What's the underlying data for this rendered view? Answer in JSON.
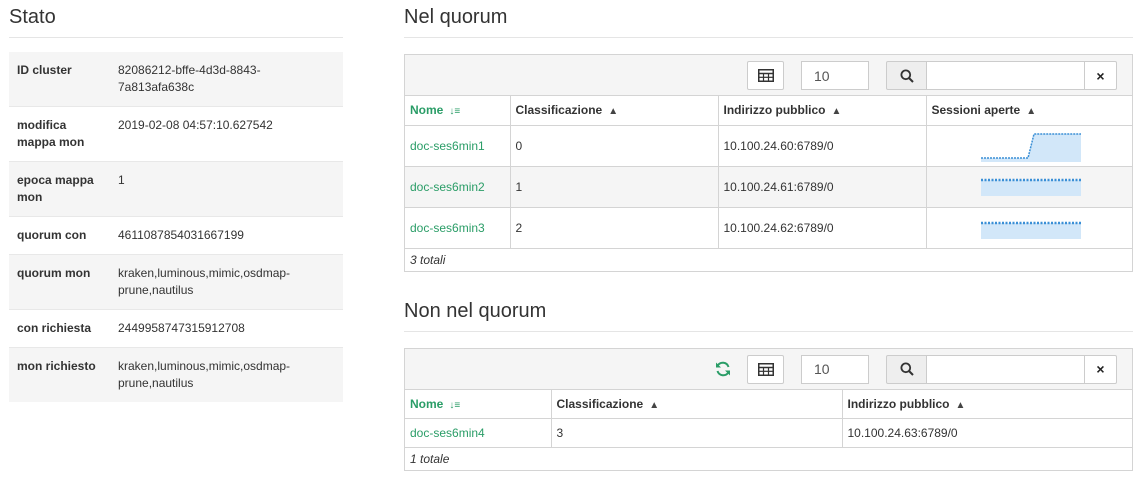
{
  "status": {
    "title": "Stato",
    "rows": [
      {
        "key": "ID cluster",
        "value": "82086212-bffe-4d3d-8843-\n7a813afa638c"
      },
      {
        "key": "modifica mappa mon",
        "value": "2019-02-08 04:57:10.627542"
      },
      {
        "key": "epoca mappa mon",
        "value": "1"
      },
      {
        "key": "quorum con",
        "value": "4611087854031667199"
      },
      {
        "key": "quorum mon",
        "value": "kraken,luminous,mimic,osdmap-prune,nautilus"
      },
      {
        "key": "con richiesta",
        "value": "2449958747315912708"
      },
      {
        "key": "mon richiesto",
        "value": "kraken,luminous,mimic,osdmap-prune,nautilus"
      }
    ]
  },
  "in_quorum": {
    "title": "Nel quorum",
    "page_size": "10",
    "search_placeholder": "",
    "clear_label": "×",
    "columns": [
      "Nome",
      "Classificazione",
      "Indirizzo pubblico",
      "Sessioni aperte"
    ],
    "rows": [
      {
        "name": "doc-ses6min1",
        "rank": "0",
        "address": "10.100.24.60:6789/0"
      },
      {
        "name": "doc-ses6min2",
        "rank": "1",
        "address": "10.100.24.61:6789/0"
      },
      {
        "name": "doc-ses6min3",
        "rank": "2",
        "address": "10.100.24.62:6789/0"
      }
    ],
    "footer": "3 totali"
  },
  "not_in_quorum": {
    "title": "Non nel quorum",
    "page_size": "10",
    "search_placeholder": "",
    "clear_label": "×",
    "columns": [
      "Nome",
      "Classificazione",
      "Indirizzo pubblico"
    ],
    "rows": [
      {
        "name": "doc-ses6min4",
        "rank": "3",
        "address": "10.100.24.63:6789/0"
      }
    ],
    "footer": "1 totale"
  },
  "colors": {
    "accent": "#2a9d67",
    "spark_line": "#3a8fd6",
    "spark_fill": "#d2e7f9"
  }
}
